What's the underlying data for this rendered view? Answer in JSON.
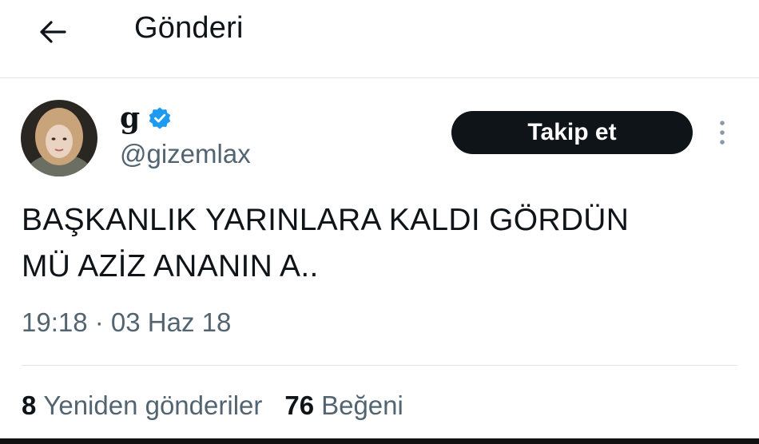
{
  "header": {
    "title": "Gönderi",
    "back_icon": "arrow-left-icon"
  },
  "author": {
    "display_name": "g",
    "handle": "@gizemlax",
    "verified_icon": "verified-badge-icon",
    "verified_color": "#1d9bf0"
  },
  "follow_button": {
    "label": "Takip et"
  },
  "more_icon": "more-vertical-icon",
  "post": {
    "text": "BAŞKANLIK YARINLARA KALDI GÖRDÜN\nMÜ AZİZ ANANIN A..",
    "timestamp": "19:18 · 03 Haz 18"
  },
  "stats": {
    "retweets_count": "8",
    "retweets_label": "Yeniden gönderiler",
    "likes_count": "76",
    "likes_label": "Beğeni"
  },
  "colors": {
    "text": "#0f1419",
    "secondary": "#536471",
    "divider": "#e3e6e9"
  }
}
